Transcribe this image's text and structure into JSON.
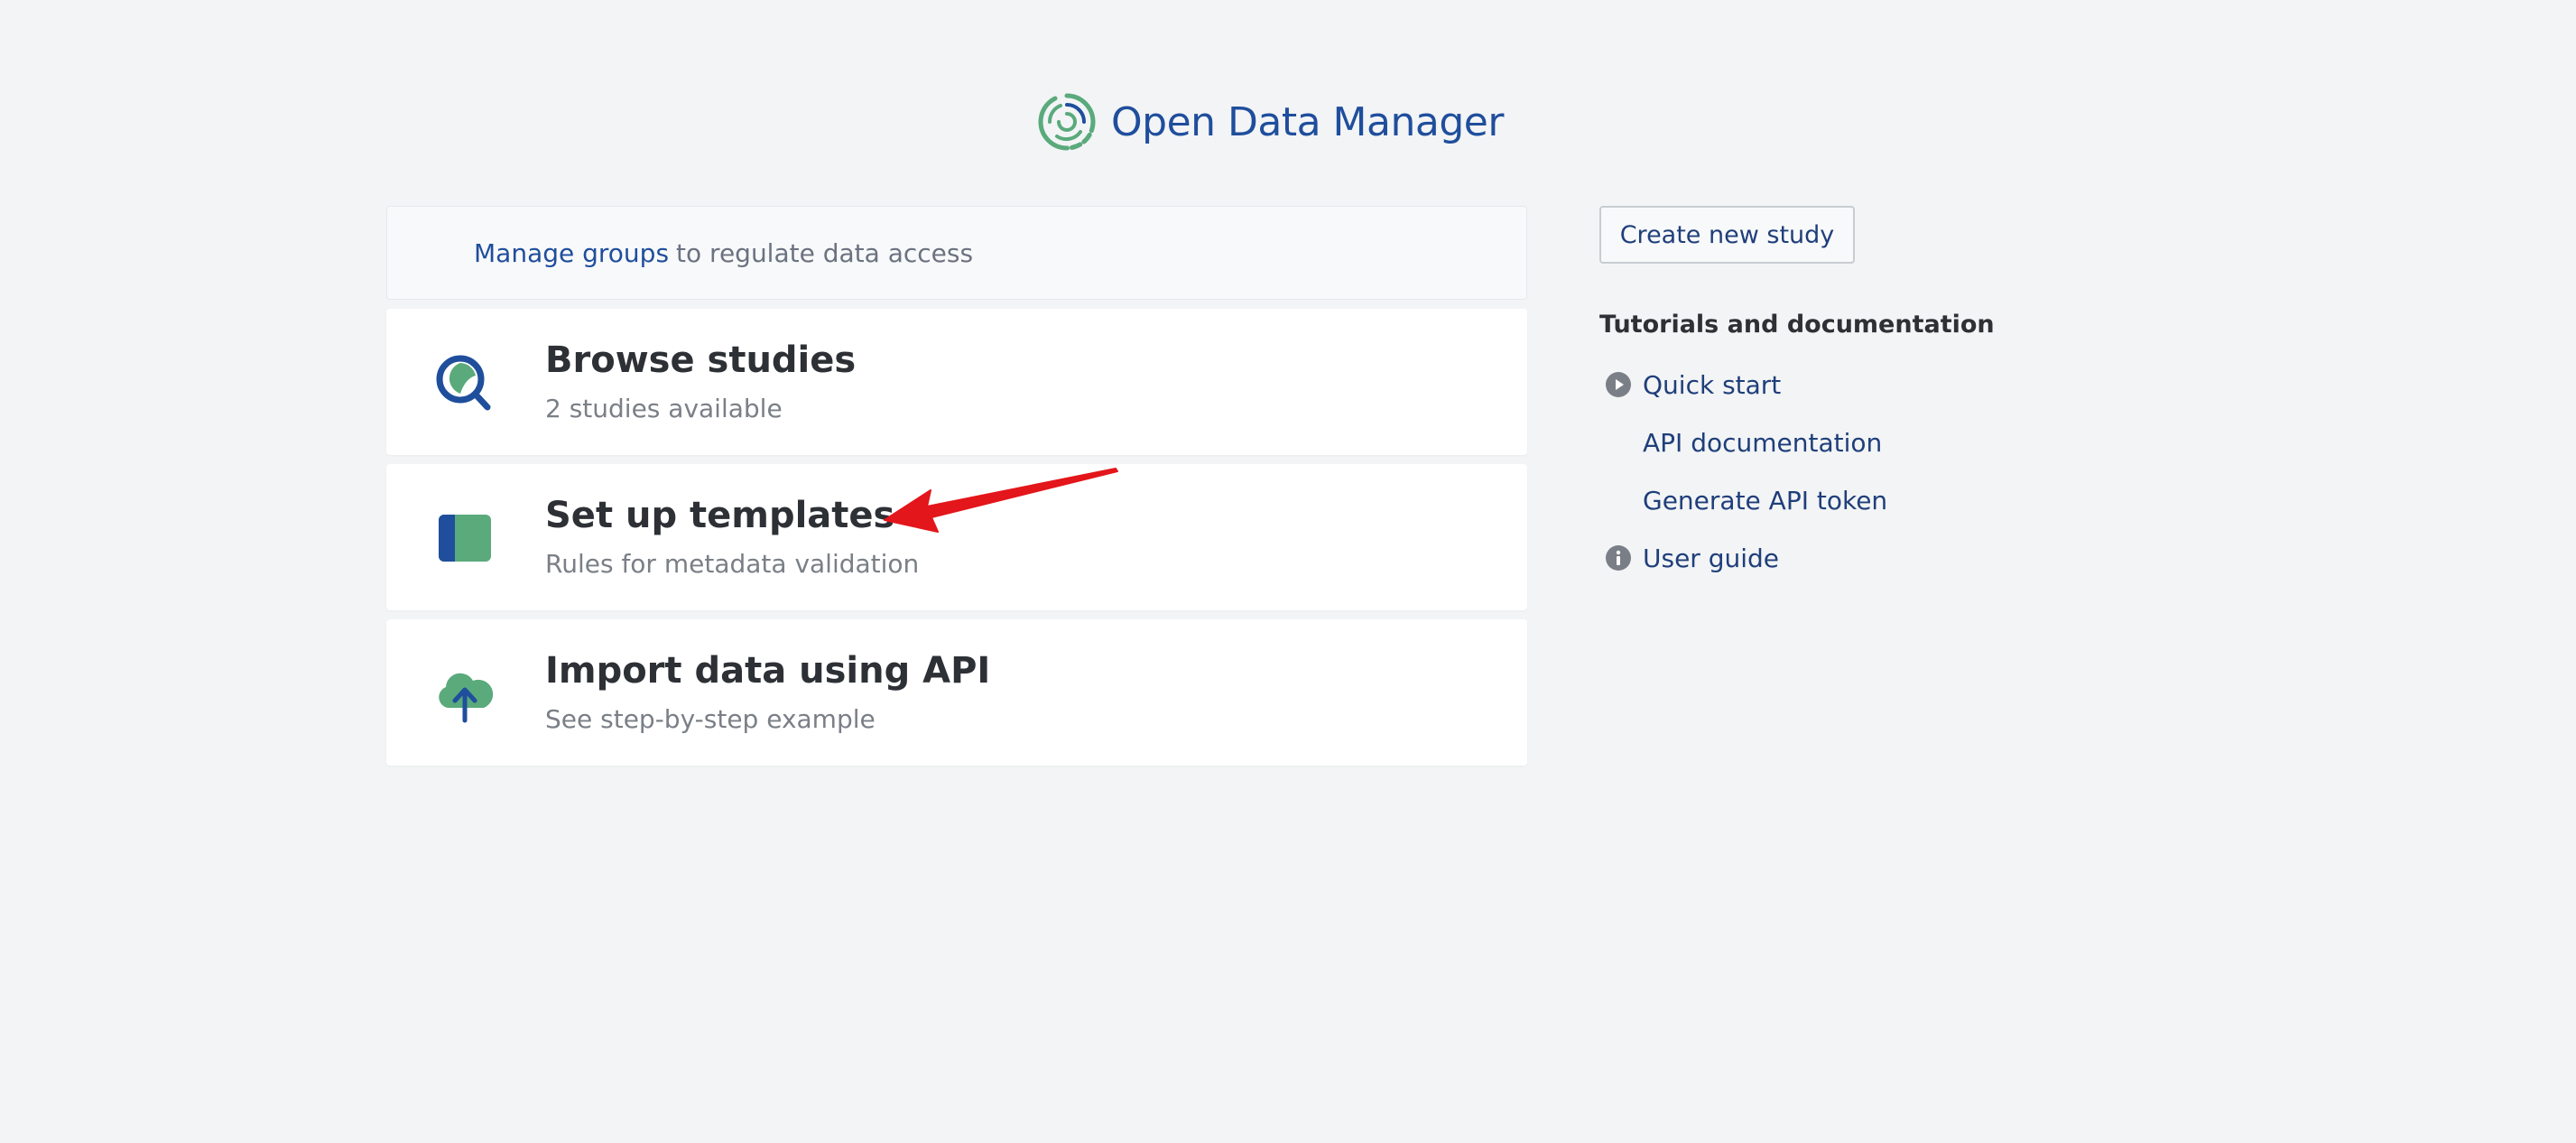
{
  "header": {
    "app_name": "Open Data Manager",
    "logo_icon": "open-data-manager-logo-icon",
    "brand_color": "#1f4e9c",
    "accent_color": "#5aaa7c"
  },
  "banner": {
    "link_text": "Manage groups",
    "rest_text": "to regulate data access"
  },
  "cards": [
    {
      "title": "Browse studies",
      "subtitle": "2 studies available",
      "icon": "magnifier-icon"
    },
    {
      "title": "Set up templates",
      "subtitle": "Rules for metadata validation",
      "icon": "template-panel-icon"
    },
    {
      "title": "Import data using API",
      "subtitle": "See step-by-step example",
      "icon": "cloud-upload-icon"
    }
  ],
  "sidebar": {
    "create_button_label": "Create new study",
    "tutorials_heading": "Tutorials and documentation",
    "links": [
      {
        "label": "Quick start",
        "icon": "play-circle-icon"
      },
      {
        "label": "API documentation",
        "icon": ""
      },
      {
        "label": "Generate API token",
        "icon": ""
      },
      {
        "label": "User guide",
        "icon": "info-circle-icon"
      }
    ]
  },
  "annotation": {
    "arrow_color": "#e3161b",
    "target": "Set up templates"
  }
}
